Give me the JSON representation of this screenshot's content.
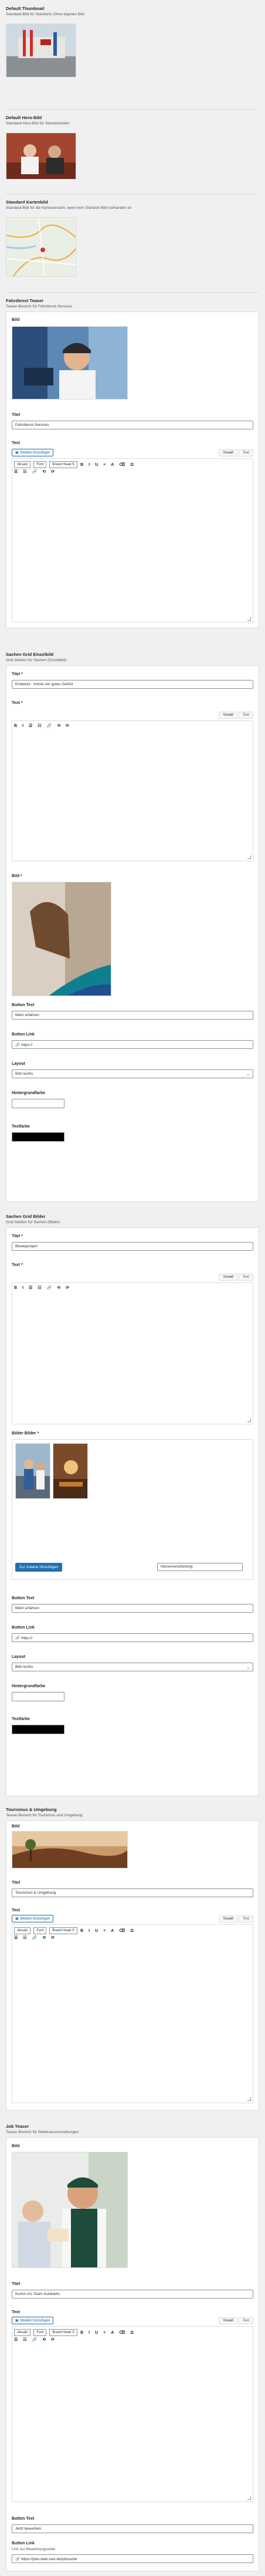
{
  "thumbnail": {
    "title": "Default Thumbnail",
    "desc": "Standard-Bild für Standorte Ohne eigenes Bild"
  },
  "hero": {
    "title": "Default Hero-Bild",
    "desc": "Standard-Hero-Bild für Standortseiten"
  },
  "map": {
    "title": "Standard Kartenbild",
    "desc": "Standard-Bild für die Kartenansicht, wenn kein Standort-Bild vorhanden ist"
  },
  "fahrdienst": {
    "title": "Fahrdienst Teaser",
    "desc": "Teaser-Bereich für Fahrdienst-Services",
    "bild_label": "Bild",
    "titel_label": "Titel",
    "titel_value": "Fahrdienst-Services",
    "text_label": "Text"
  },
  "editor": {
    "media_label": "Medien hinzufügen",
    "visual": "Visuell",
    "text": "Text",
    "paragraph": "Absatz",
    "font": "Font",
    "size": "Brand Head S",
    "toolbar1": [
      "B",
      "I",
      "U",
      "≡",
      "A",
      "⌫",
      "Ω"
    ],
    "toolbar2": [
      "☰",
      "☷",
      "🔗",
      "⟲",
      "⟳"
    ]
  },
  "sachen": {
    "title": "Sachen Grid Einzelbild",
    "desc": "Grid-Sektion für Sachen (Einzelbild)",
    "titel_label": "Titel *",
    "titel_value": "Entdeckt - immer ein gutes Gefühl",
    "text_label": "Text *",
    "bild_label": "Bild *",
    "button_text_label": "Button Text",
    "button_text_value": "Mehr erfahren",
    "button_link_label": "Button Link",
    "button_link_value": "https://",
    "layout_label": "Layout",
    "layout_value": "Bild rechts",
    "hg_label": "Hintergrundfarbe",
    "tf_label": "Textfarbe"
  },
  "sachen_bilder": {
    "title": "Sachen Grid Bilder",
    "desc": "Grid-Sektion für Sachen (Bilder)",
    "titel_label": "Titel *",
    "titel_value": "Bewegungen",
    "text_label": "Text *",
    "bilder_label": "Bilder Bilder *",
    "galerie_button": "Zur Galerie hinzufügen",
    "galerie_select": "Massenverarbeitung",
    "button_text_label": "Button Text",
    "button_text_value": "Mehr erfahren",
    "button_link_label": "Button Link",
    "button_link_value": "https://",
    "layout_label": "Layout",
    "layout_value": "Bild rechts",
    "hg_label": "Hintergrundfarbe",
    "tf_label": "Textfarbe"
  },
  "tourismus": {
    "title": "Tourismus & Umgebung",
    "desc": "Teaser-Bereich für Tourismus und Umgebung",
    "bild_label": "Bild",
    "titel_label": "Titel",
    "titel_value": "Tourismus & Umgebung",
    "text_label": "Text"
  },
  "job": {
    "title": "Job Teaser",
    "desc": "Teaser-Bereich für Stellenausschreibungen",
    "bild_label": "Bild",
    "titel_label": "Titel",
    "titel_value": "Komm ins Team Autobahn.",
    "text_label": "Text",
    "button_text_label": "Button Text",
    "button_text_value": "Jetzt bewerben",
    "button_link_label": "Button Link",
    "button_link_desc": "Link zur Bewerbungsseite",
    "button_link_value": "https://jobs.tank-rast.de/jobsuche"
  },
  "colors": {
    "accent": "#2271b1",
    "text_black": "#000000"
  }
}
